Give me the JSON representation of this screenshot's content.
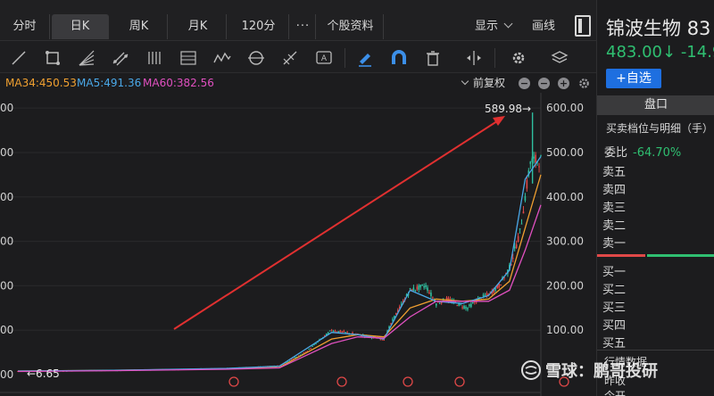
{
  "tabs": [
    {
      "label": "分时",
      "active": false
    },
    {
      "label": "日K",
      "active": true
    },
    {
      "label": "周K",
      "active": false
    },
    {
      "label": "月K",
      "active": false
    },
    {
      "label": "120分",
      "active": false
    },
    {
      "label": "···",
      "active": false
    },
    {
      "label": "个股资料",
      "active": false
    }
  ],
  "display_menu": "显示",
  "draw_label": "画线",
  "toolbar_icons": [
    "line-tool-icon",
    "rect-tool-icon",
    "fan-tool-icon",
    "channel-tool-icon",
    "parallel-tool-icon",
    "fib-tool-icon",
    "wave-tool-icon",
    "cycle-tool-icon",
    "gann-tool-icon",
    "text-tool-icon",
    "pen-tool-icon",
    "magnet-icon",
    "trash-icon",
    "measure-icon",
    "settings-icon",
    "layers-icon"
  ],
  "ma_legend": [
    {
      "label": "MA34:450.53",
      "color": "#f0a030"
    },
    {
      "label": "MA5:491.36",
      "color": "#4aa8e8"
    },
    {
      "label": "MA60:382.56",
      "color": "#e050c0"
    }
  ],
  "adjust_label": "前复权",
  "chart_data": {
    "type": "candlestick",
    "y_ticks_right": [
      "600.00",
      "500.00",
      "400.00",
      "300.00",
      "200.00",
      "100.00"
    ],
    "y_ticks_left": [
      "00",
      "00",
      "00",
      "00",
      "00",
      "00",
      "00"
    ],
    "ylim": [
      0,
      600
    ],
    "high_label": "589.98→",
    "low_label": "←6.65",
    "high": 589.98,
    "low": 6.65,
    "series": [
      {
        "name": "close",
        "x": [
          0,
          10,
          20,
          30,
          40,
          50,
          55,
          60,
          65,
          70,
          72,
          75,
          78,
          80,
          82,
          84,
          86,
          88,
          90,
          92,
          94,
          96,
          98,
          100
        ],
        "y": [
          8,
          9,
          10,
          12,
          14,
          20,
          50,
          100,
          90,
          80,
          130,
          190,
          200,
          160,
          170,
          160,
          150,
          170,
          180,
          200,
          240,
          320,
          480,
          483
        ]
      },
      {
        "name": "MA34",
        "x": [
          0,
          20,
          40,
          50,
          60,
          65,
          70,
          75,
          80,
          85,
          90,
          94,
          97,
          100
        ],
        "y": [
          8,
          10,
          13,
          16,
          80,
          90,
          85,
          150,
          170,
          165,
          170,
          210,
          330,
          450
        ]
      },
      {
        "name": "MA5",
        "x": [
          0,
          20,
          40,
          50,
          60,
          65,
          70,
          75,
          80,
          85,
          90,
          94,
          97,
          100
        ],
        "y": [
          8,
          10,
          14,
          19,
          95,
          90,
          80,
          190,
          165,
          160,
          178,
          235,
          440,
          491
        ]
      },
      {
        "name": "MA60",
        "x": [
          0,
          20,
          40,
          50,
          60,
          65,
          70,
          75,
          80,
          85,
          90,
          94,
          97,
          100
        ],
        "y": [
          7,
          9,
          12,
          15,
          70,
          85,
          82,
          130,
          165,
          165,
          165,
          190,
          280,
          382
        ]
      }
    ]
  },
  "stock": {
    "name": "锦波生物",
    "code_partial": "83",
    "price": "483.00↓",
    "change": "-14.9"
  },
  "add_watch": "+自选",
  "panel_title": "盘口",
  "depth_title": "买卖档位与明细（手）",
  "webi_label": "委比",
  "webi_value": "-64.70%",
  "asks": [
    "卖五",
    "卖四",
    "卖三",
    "卖二",
    "卖一"
  ],
  "bids": [
    "买一",
    "买二",
    "买三",
    "买四",
    "买五"
  ],
  "market_data_label": "行情数据",
  "prev_close_label": "昨收",
  "open_label": "今开",
  "watermark": "雪球：鹏哥投研"
}
